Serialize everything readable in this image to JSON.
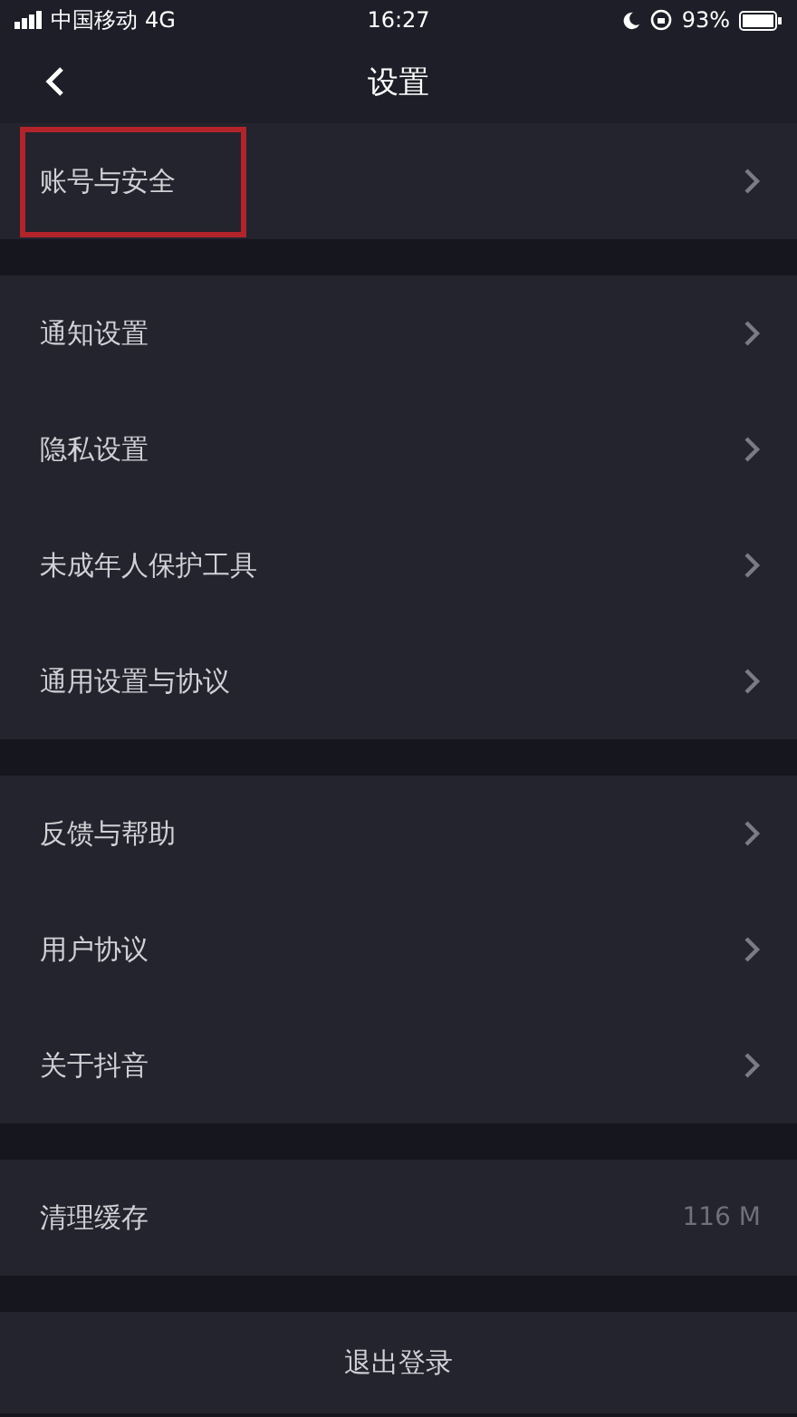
{
  "status_bar": {
    "carrier": "中国移动",
    "network": "4G",
    "time": "16:27",
    "battery": "93%"
  },
  "nav": {
    "title": "设置"
  },
  "sections": [
    {
      "items": [
        {
          "label": "账号与安全",
          "highlighted": true
        }
      ]
    },
    {
      "items": [
        {
          "label": "通知设置",
          "highlighted": false
        },
        {
          "label": "隐私设置",
          "highlighted": false
        },
        {
          "label": "未成年人保护工具",
          "highlighted": false
        },
        {
          "label": "通用设置与协议",
          "highlighted": false
        }
      ]
    },
    {
      "items": [
        {
          "label": "反馈与帮助",
          "highlighted": false
        },
        {
          "label": "用户协议",
          "highlighted": false
        },
        {
          "label": "关于抖音",
          "highlighted": false
        }
      ]
    },
    {
      "items": [
        {
          "label": "清理缓存",
          "value": "116 M",
          "highlighted": false
        }
      ]
    }
  ],
  "logout": "退出登录"
}
